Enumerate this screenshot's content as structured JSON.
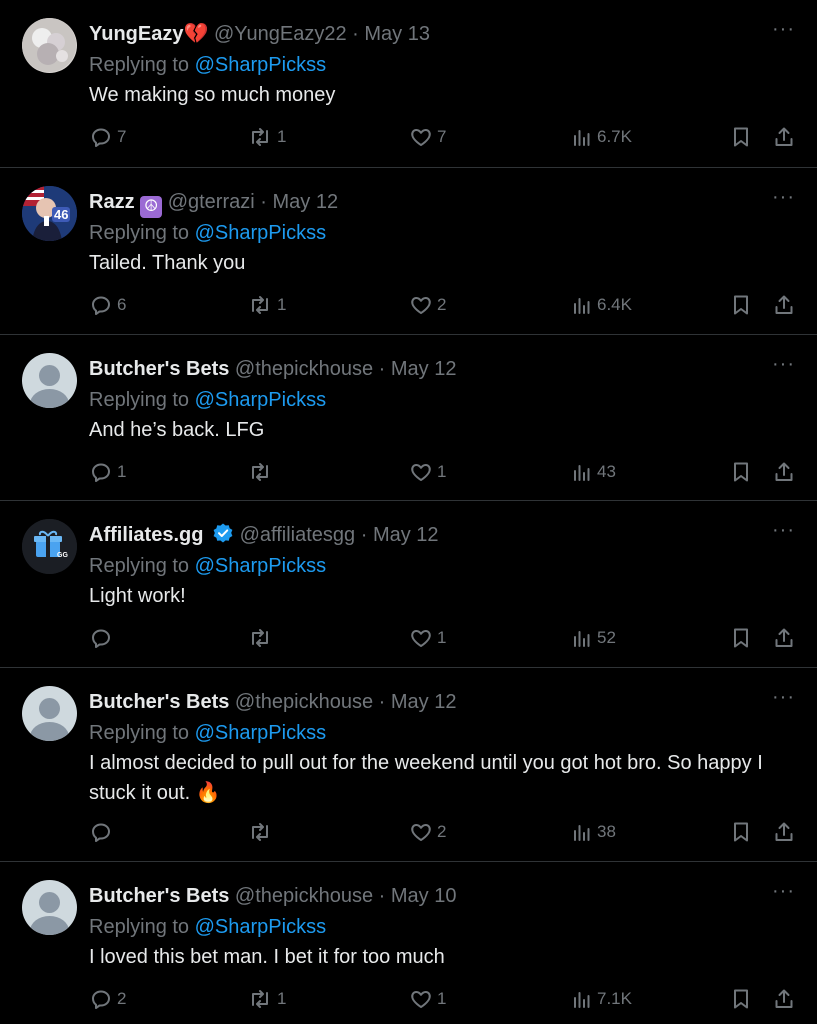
{
  "tweets": [
    {
      "name": "YungEazy",
      "name_emoji": "💔",
      "handle": "@YungEazy22",
      "date": "May 13",
      "replying_label": "Replying to",
      "replying_to": "@SharpPickss",
      "text": "We making so much money",
      "replies": "7",
      "retweets": "1",
      "likes": "7",
      "views": "6.7K",
      "avatar": "yungeazy-avatar"
    },
    {
      "name": "Razz",
      "name_emoji": "☮",
      "handle": "@gterrazi",
      "date": "May 12",
      "replying_label": "Replying to",
      "replying_to": "@SharpPickss",
      "text": "Tailed. Thank you",
      "replies": "6",
      "retweets": "1",
      "likes": "2",
      "views": "6.4K",
      "avatar": "razz-avatar",
      "avatar_badge": "46"
    },
    {
      "name": "Butcher's Bets",
      "handle": "@thepickhouse",
      "date": "May 12",
      "replying_label": "Replying to",
      "replying_to": "@SharpPickss",
      "text": "And he’s back. LFG",
      "replies": "1",
      "retweets": "",
      "likes": "1",
      "views": "43",
      "avatar": "default-avatar"
    },
    {
      "name": "Affiliates.gg",
      "handle": "@affiliatesgg",
      "date": "May 12",
      "replying_label": "Replying to",
      "replying_to": "@SharpPickss",
      "text": "Light work!",
      "replies": "",
      "retweets": "",
      "likes": "1",
      "views": "52",
      "avatar": "affiliates-avatar",
      "avatar_badge": "GG"
    },
    {
      "name": "Butcher's Bets",
      "handle": "@thepickhouse",
      "date": "May 12",
      "replying_label": "Replying to",
      "replying_to": "@SharpPickss",
      "text": "I almost decided to pull out for the weekend until you got hot bro. So happy I stuck it out. 🔥",
      "replies": "",
      "retweets": "",
      "likes": "2",
      "views": "38",
      "avatar": "default-avatar"
    },
    {
      "name": "Butcher's Bets",
      "handle": "@thepickhouse",
      "date": "May 10",
      "replying_label": "Replying to",
      "replying_to": "@SharpPickss",
      "text": "I loved this bet man. I bet it for too much",
      "replies": "2",
      "retweets": "1",
      "likes": "1",
      "views": "7.1K",
      "avatar": "default-avatar"
    }
  ],
  "separator": "·",
  "more_glyph": "···",
  "colors": {
    "background": "#000000",
    "text": "#e7e9ea",
    "muted": "#71767b",
    "link": "#1d9bf0",
    "divider": "#2f3336",
    "verified": "#1d9bf0"
  }
}
